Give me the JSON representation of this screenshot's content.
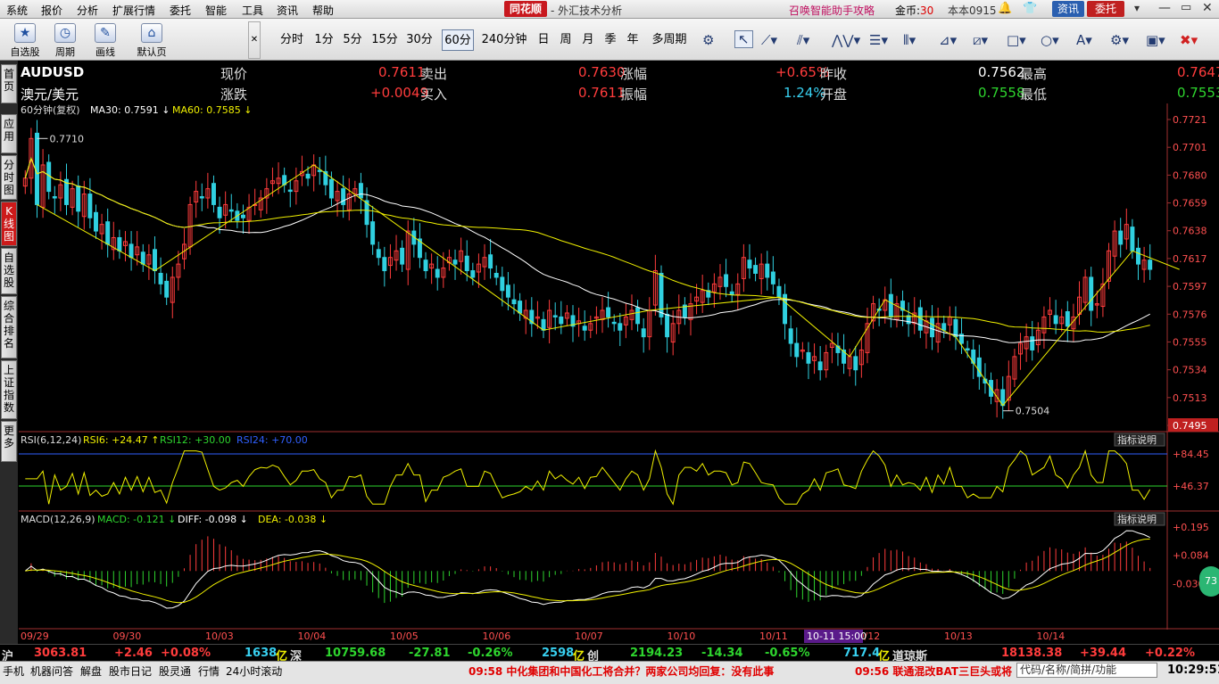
{
  "menu": [
    "系统",
    "报价",
    "分析",
    "扩展行情",
    "委托",
    "智能",
    "工具",
    "资讯",
    "帮助"
  ],
  "brand": "同花顺",
  "app_title": "- 外汇技术分析",
  "assistant": "召唤智能助手攻略",
  "coins_label": "金币:",
  "coins_value": "30",
  "version": "本本0915",
  "top_buttons": {
    "news": "资讯",
    "trade": "委托"
  },
  "toolbar_big": [
    "自选股",
    "周期",
    "画线",
    "默认页"
  ],
  "periods": [
    "分时",
    "1分",
    "5分",
    "15分",
    "30分",
    "60分",
    "240分钟",
    "日",
    "周",
    "月",
    "季",
    "年",
    "多周期"
  ],
  "selected_period": "60分",
  "side_tabs": [
    "首页",
    "应用",
    "分时图",
    "K线图",
    "自选股",
    "综合排名",
    "上证指数",
    "更多"
  ],
  "quote": {
    "symbol": "AUDUSD",
    "name": "澳元/美元",
    "price_label": "现价",
    "price": "0.7611",
    "change_label": "涨跌",
    "change": "+0.0049",
    "sell_label": "卖出",
    "sell": "0.7630",
    "buy_label": "买入",
    "buy": "0.7611",
    "pct_label": "涨幅",
    "pct": "+0.65%",
    "amp_label": "振幅",
    "amp": "1.24%",
    "prevclose_label": "昨收",
    "prevclose": "0.7562",
    "open_label": "开盘",
    "open": "0.7558",
    "high_label": "最高",
    "high": "0.7647",
    "low_label": "最低",
    "low": "0.7553"
  },
  "indicator_buttons": {
    "rsi": "指标说明",
    "macd": "指标说明"
  },
  "colors": {
    "up": "#ff3c3c",
    "down": "#2ed52e",
    "ma30": "#ffffff",
    "ma60": "#f0f000",
    "rsi6": "#f0f000",
    "rsi12": "#2ed52e",
    "rsi24": "#3060ff"
  },
  "chart_data": [
    {
      "type": "candlestick",
      "title": "60分钟(复权)",
      "legend": [
        {
          "label": "MA30: 0.7591",
          "dir": "down"
        },
        {
          "label": "MA60: 0.7585",
          "dir": "down"
        }
      ],
      "x_ticks": [
        "09/29",
        "09/30",
        "10/03",
        "10/04",
        "10/05",
        "10/06",
        "10/07",
        "10/10",
        "10/11",
        "10/12",
        "10/13",
        "10/14"
      ],
      "y_ticks": [
        "0.7721",
        "0.7701",
        "0.7680",
        "0.7659",
        "0.7638",
        "0.7617",
        "0.7597",
        "0.7576",
        "0.7555",
        "0.7534",
        "0.7513",
        "0.7495"
      ],
      "ylim": [
        0.7495,
        0.7721
      ],
      "annotations": [
        {
          "label": "0.7710",
          "value": 0.771,
          "bar": 2
        },
        {
          "label": "0.7504",
          "value": 0.7504,
          "bar": 166
        }
      ],
      "cursor_label": "10-11 15:00",
      "closes": [
        0.768,
        0.771,
        0.766,
        0.769,
        0.767,
        0.7665,
        0.7675,
        0.766,
        0.7672,
        0.7655,
        0.7668,
        0.765,
        0.764,
        0.7645,
        0.763,
        0.7635,
        0.7625,
        0.7632,
        0.762,
        0.7628,
        0.7615,
        0.7622,
        0.761,
        0.76,
        0.759,
        0.7605,
        0.7615,
        0.763,
        0.766,
        0.767,
        0.7665,
        0.7672,
        0.766,
        0.765,
        0.766,
        0.7655,
        0.7648,
        0.765,
        0.7658,
        0.766,
        0.7665,
        0.7672,
        0.7678,
        0.768,
        0.7675,
        0.767,
        0.7678,
        0.7685,
        0.768,
        0.769,
        0.7685,
        0.7675,
        0.7665,
        0.767,
        0.766,
        0.7668,
        0.7672,
        0.7665,
        0.7645,
        0.763,
        0.762,
        0.761,
        0.762,
        0.7625,
        0.7615,
        0.764,
        0.763,
        0.762,
        0.761,
        0.7615,
        0.7605,
        0.7612,
        0.762,
        0.7615,
        0.7625,
        0.761,
        0.7605,
        0.7615,
        0.762,
        0.7612,
        0.7605,
        0.7595,
        0.759,
        0.7585,
        0.7578,
        0.758,
        0.757,
        0.7575,
        0.7565,
        0.758,
        0.7575,
        0.757,
        0.7578,
        0.7568,
        0.7572,
        0.7565,
        0.757,
        0.7575,
        0.758,
        0.7575,
        0.757,
        0.7565,
        0.7575,
        0.758,
        0.757,
        0.756,
        0.758,
        0.761,
        0.7575,
        0.756,
        0.757,
        0.758,
        0.7575,
        0.7585,
        0.759,
        0.7595,
        0.759,
        0.76,
        0.7605,
        0.7598,
        0.7592,
        0.76,
        0.762,
        0.7612,
        0.7608,
        0.7615,
        0.7605,
        0.76,
        0.759,
        0.757,
        0.7555,
        0.7545,
        0.755,
        0.754,
        0.7545,
        0.7535,
        0.7548,
        0.7555,
        0.7548,
        0.754,
        0.7545,
        0.7535,
        0.755,
        0.757,
        0.7585,
        0.758,
        0.7588,
        0.7575,
        0.7585,
        0.758,
        0.757,
        0.7578,
        0.7565,
        0.7572,
        0.756,
        0.757,
        0.7565,
        0.7575,
        0.756,
        0.7555,
        0.755,
        0.754,
        0.753,
        0.7525,
        0.7515,
        0.752,
        0.7508,
        0.753,
        0.7545,
        0.7555,
        0.756,
        0.755,
        0.7565,
        0.7575,
        0.758,
        0.757,
        0.7575,
        0.7568,
        0.7575,
        0.759,
        0.7605,
        0.758,
        0.7585,
        0.76,
        0.7625,
        0.764,
        0.763,
        0.7645,
        0.7625,
        0.7615,
        0.7618,
        0.7611
      ]
    },
    {
      "type": "line",
      "title": "RSI(6,12,24)",
      "legend": [
        {
          "label": "RSI6: +24.47",
          "dir": "up"
        },
        {
          "label": "RSI12: +30.00",
          "dir": "none"
        },
        {
          "label": "RSI24: +70.00",
          "dir": "none"
        }
      ],
      "y_ticks": [
        "+84.45",
        "+46.37"
      ],
      "levels": [
        84.45,
        46.37
      ]
    },
    {
      "type": "bar",
      "title": "MACD(12,26,9)",
      "legend": [
        {
          "label": "MACD: -0.121",
          "dir": "down"
        },
        {
          "label": "DIFF: -0.098",
          "dir": "down"
        },
        {
          "label": "DEA: -0.038",
          "dir": "down"
        }
      ],
      "y_ticks": [
        "+0.195",
        "+0.084",
        "-0.030"
      ]
    }
  ],
  "status_indices": [
    {
      "label": "沪",
      "value": "3063.81",
      "change": "+2.46",
      "pct": "+0.08%",
      "amount": "1638",
      "unit": "亿"
    },
    {
      "label": "深",
      "value": "10759.68",
      "change": "-27.81",
      "pct": "-0.26%",
      "amount": "2598",
      "unit": "亿"
    },
    {
      "label": "创",
      "value": "2194.23",
      "change": "-14.34",
      "pct": "-0.65%",
      "amount": "717.4",
      "unit": "亿"
    },
    {
      "label": "道琼斯",
      "value": "18138.38",
      "change": "+39.44",
      "pct": "+0.22%"
    }
  ],
  "bottom_buttons": [
    "手机",
    "机器问答",
    "解盘",
    "股市日记",
    "股灵通",
    "行情",
    "24小时滚动"
  ],
  "news1": "09:58 中化集团和中国化工将合并？两家公司均回复：没有此事",
  "news2": "09:56 联通混改BAT三巨头或将",
  "search_placeholder": "代码/名称/简拼/功能",
  "clock": "10:29:51",
  "badge": "73"
}
